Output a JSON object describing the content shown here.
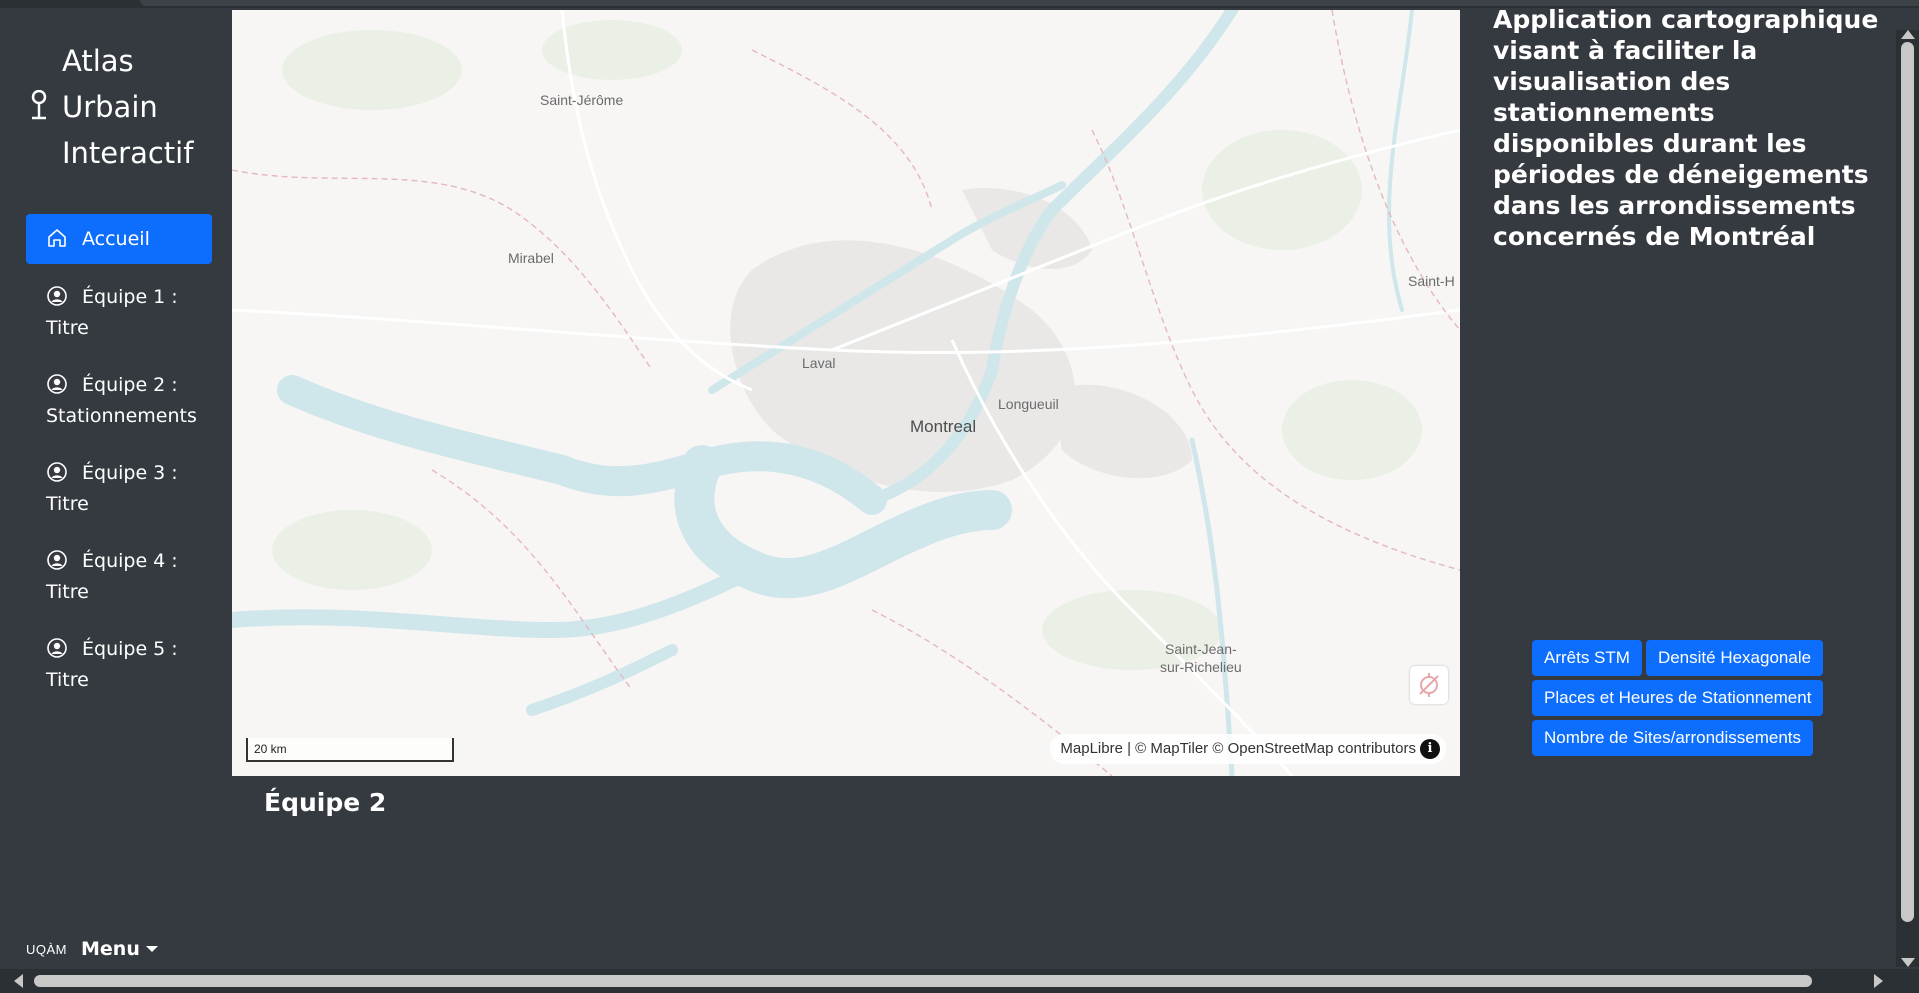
{
  "brand": {
    "lines": [
      "Atlas",
      "Urbain",
      "Interactif"
    ],
    "icon": "map-pin-icon"
  },
  "nav": {
    "items": [
      {
        "label": "Accueil",
        "icon": "home-icon",
        "active": true
      },
      {
        "label": "Équipe 1 : Titre",
        "icon": "user-circle-icon"
      },
      {
        "label": "Équipe 2 : Stationnements",
        "icon": "user-circle-icon"
      },
      {
        "label": "Équipe 3 : Titre",
        "icon": "user-circle-icon"
      },
      {
        "label": "Équipe 4 : Titre",
        "icon": "user-circle-icon"
      },
      {
        "label": "Équipe 5 : Titre",
        "icon": "user-circle-icon"
      }
    ]
  },
  "footer_menu": {
    "logo_text": "UQÀM",
    "label": "Menu"
  },
  "map": {
    "labels": {
      "saint_jerome": "Saint-Jérôme",
      "mirabel": "Mirabel",
      "laval": "Laval",
      "montreal": "Montreal",
      "longueuil": "Longueuil",
      "saint_h": "Saint-H",
      "saint_jean": "Saint-Jean-\nsur-Richelieu"
    },
    "scale": "20 km",
    "attribution": "MapLibre | © MapTiler © OpenStreetMap contributors",
    "info_icon": "i"
  },
  "team_title": "Équipe 2",
  "description": "Application cartographique visant à faciliter la visualisation des stationnements disponibles durant les périodes de déneigements dans les arrondissements concernés de Montréal",
  "layers": {
    "arrets": "Arrêts STM",
    "densite": "Densité Hexagonale",
    "places": "Places et Heures de Stationnement",
    "sites": "Nombre de Sites/arrondissements"
  },
  "colors": {
    "accent": "#0d6efd",
    "background": "#343a40",
    "water": "#cfe6ea",
    "map_land": "#f7f6f4"
  }
}
